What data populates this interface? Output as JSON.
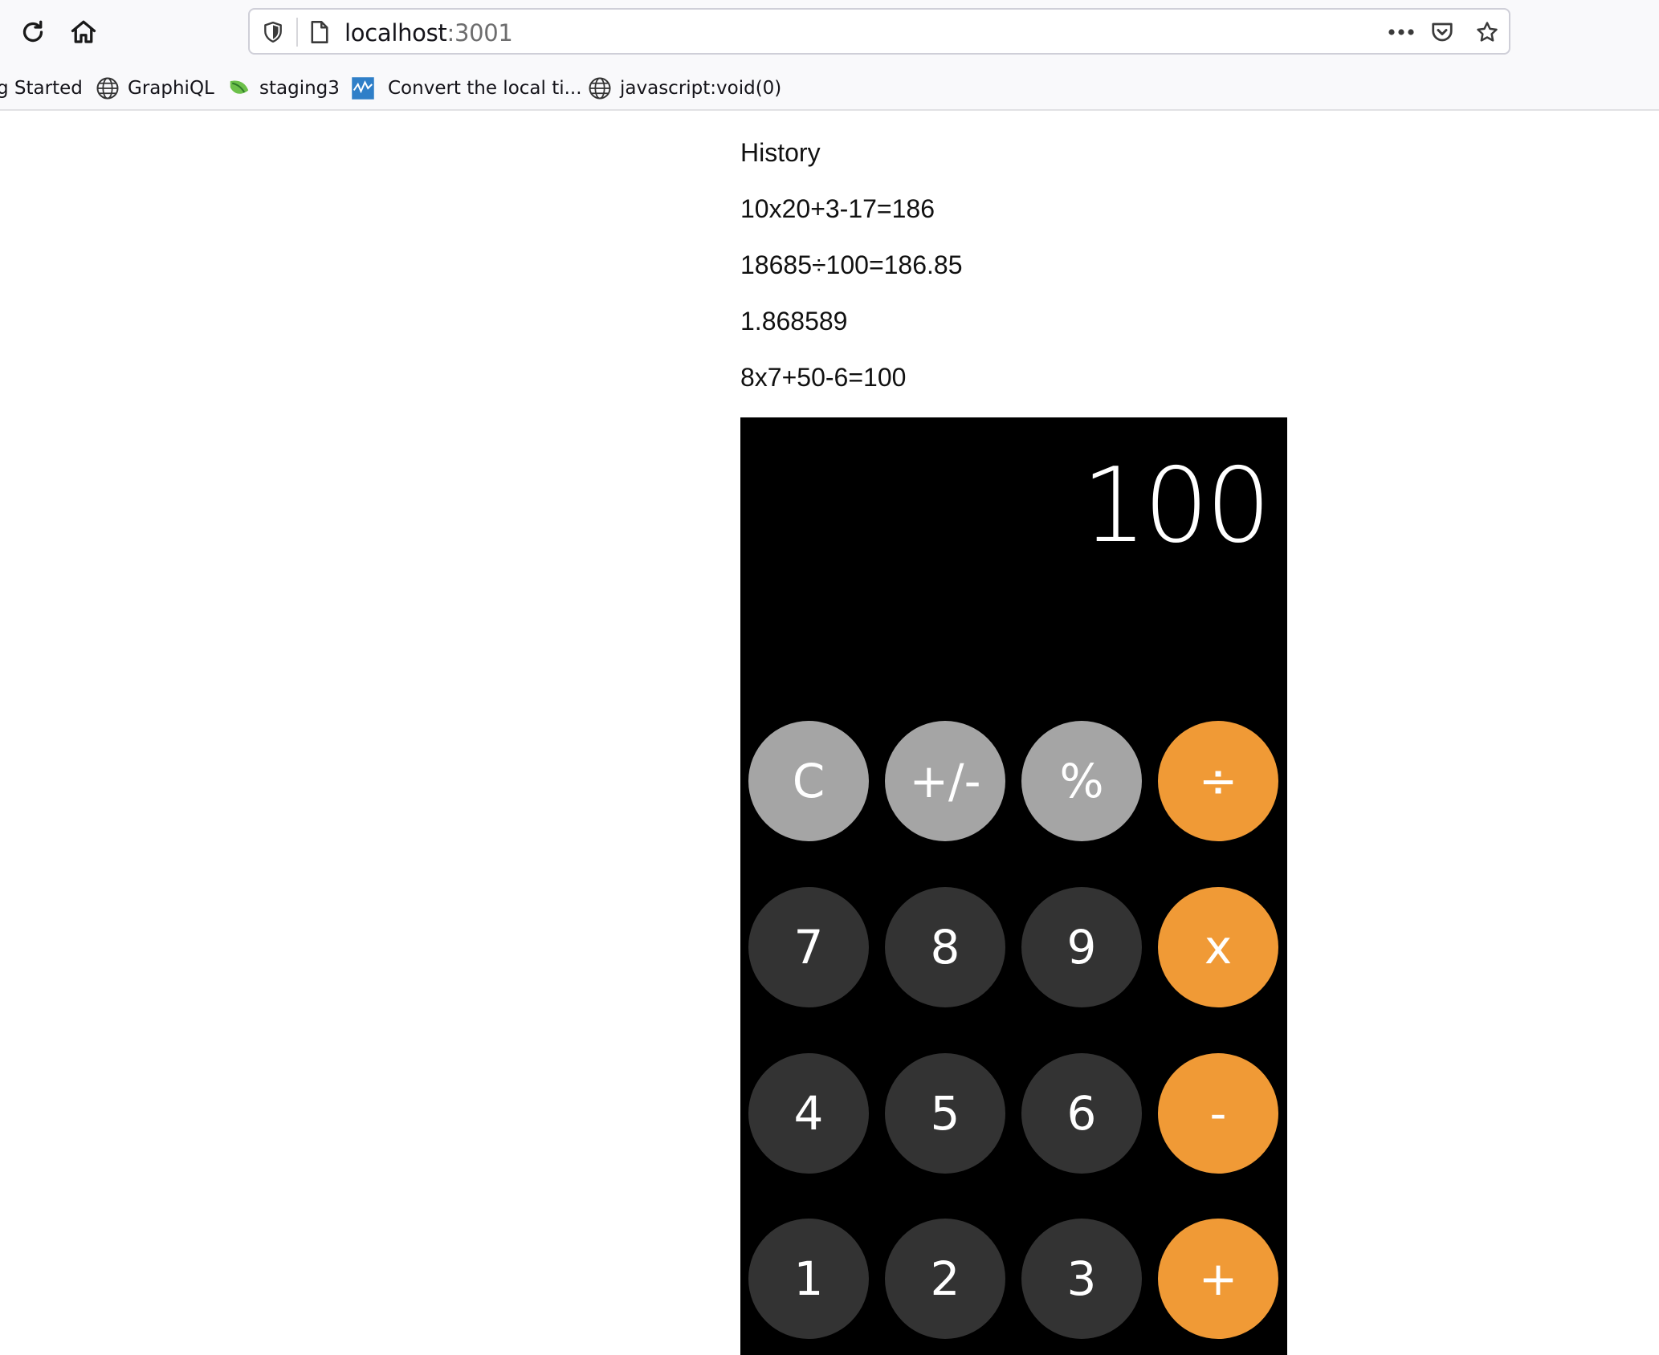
{
  "browser": {
    "url_host": "localhost",
    "url_port": ":3001",
    "bookmarks": [
      {
        "label": "g Started",
        "icon": "firefox-icon"
      },
      {
        "label": "GraphiQL",
        "icon": "globe-icon"
      },
      {
        "label": "staging3",
        "icon": "leaf-icon"
      },
      {
        "label": "Convert the local ti...",
        "icon": "chart-icon"
      },
      {
        "label": "javascript:void(0)",
        "icon": "globe-icon"
      }
    ]
  },
  "history": {
    "title": "History",
    "items": [
      "10x20+3-17=186",
      "18685÷100=186.85",
      "1.868589",
      "8x7+50-6=100"
    ]
  },
  "calculator": {
    "display": "100",
    "keys": [
      [
        "C",
        "+/-",
        "%",
        "÷"
      ],
      [
        "7",
        "8",
        "9",
        "x"
      ],
      [
        "4",
        "5",
        "6",
        "-"
      ],
      [
        "1",
        "2",
        "3",
        "+"
      ]
    ],
    "colors": {
      "function": "#a5a5a5",
      "number": "#333333",
      "operator": "#f09a36"
    }
  }
}
